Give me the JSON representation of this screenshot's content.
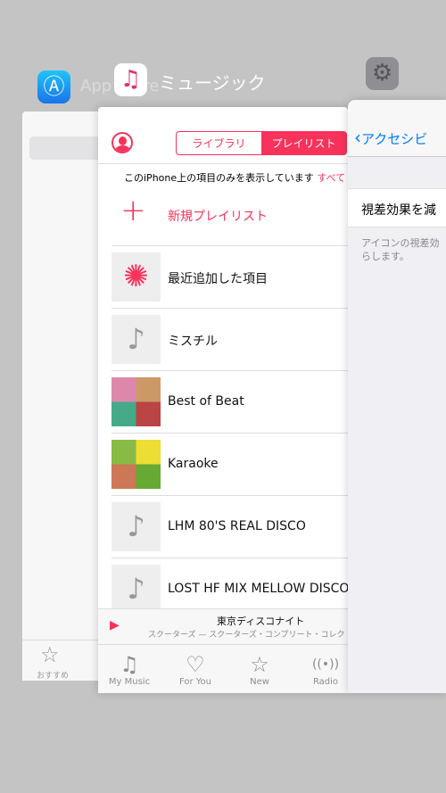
{
  "switcher": {
    "app_store": {
      "label": "App Store",
      "tab_label": "おすすめ"
    },
    "music": {
      "label": "ミュージック"
    },
    "settings": {
      "back_label": "アクセシビ",
      "cell_label": "視差効果を減",
      "footer_text": "アイコンの視差効\nらします。"
    }
  },
  "music": {
    "segments": [
      {
        "label": "ライブラリ",
        "selected": false
      },
      {
        "label": "プレイリスト",
        "selected": true
      }
    ],
    "notice": "このiPhone上の項目のみを表示しています",
    "notice_link": "すべて",
    "new_playlist": "新規プレイリスト",
    "playlists": [
      {
        "title": "最近追加した項目",
        "icon": "gear-icon"
      },
      {
        "title": "ミスチル",
        "icon": "music-note-icon"
      },
      {
        "title": "Best of Beat",
        "icon": "album-art"
      },
      {
        "title": "Karaoke",
        "icon": "album-art"
      },
      {
        "title": "LHM 80'S REAL DISCO",
        "icon": "music-note-icon"
      },
      {
        "title": "LOST HF MIX   MELLOW DISCO",
        "icon": "music-note-icon"
      }
    ],
    "now_playing": {
      "title": "東京ディスコナイト",
      "subtitle": "スクーターズ — スクーターズ・コンプリート・コレク"
    },
    "tabs": [
      {
        "label": "My Music",
        "active": true
      },
      {
        "label": "For You"
      },
      {
        "label": "New"
      },
      {
        "label": "Radio"
      }
    ]
  },
  "colors": {
    "accent": "#f7325b",
    "ios_blue": "#007aff"
  }
}
